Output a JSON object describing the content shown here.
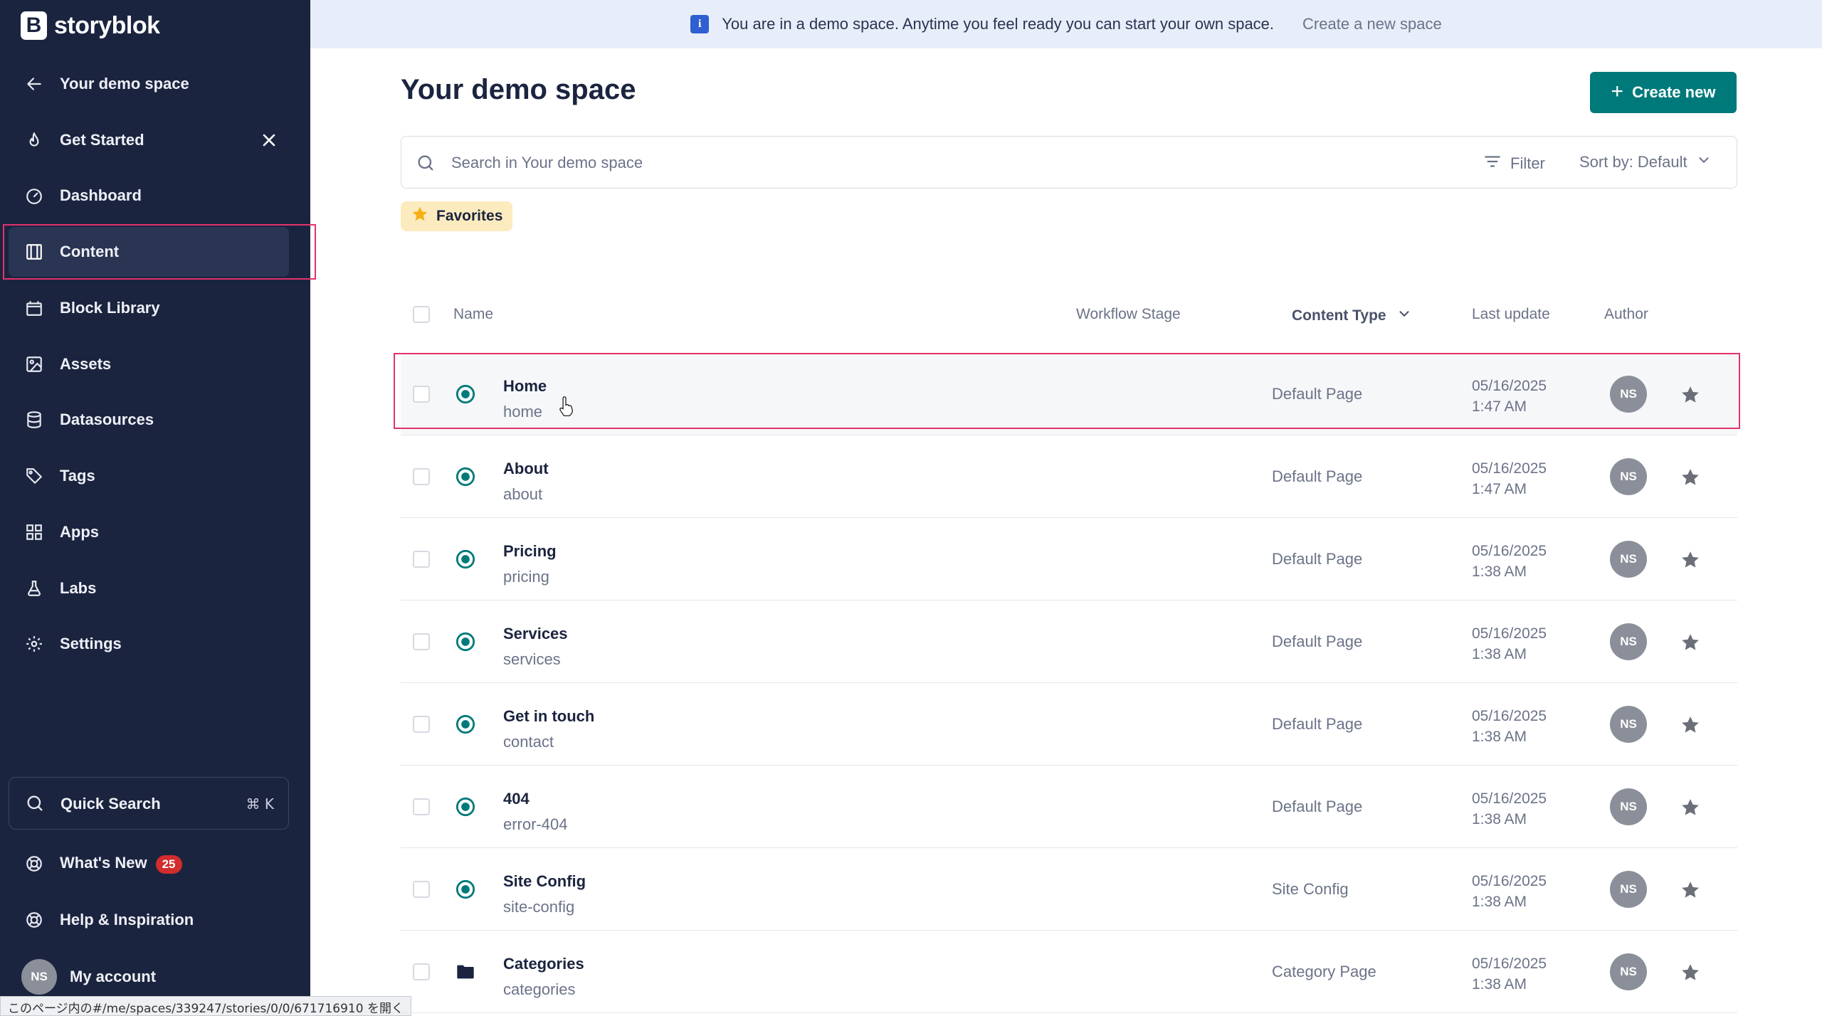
{
  "brand": {
    "logo_letter": "B",
    "name": "storyblok"
  },
  "sidebar": {
    "back_label": "Your demo space",
    "items": [
      {
        "label": "Get Started",
        "icon": "flame-icon"
      },
      {
        "label": "Dashboard",
        "icon": "gauge-icon"
      },
      {
        "label": "Content",
        "icon": "content-icon",
        "active": true
      },
      {
        "label": "Block Library",
        "icon": "block-library-icon"
      },
      {
        "label": "Assets",
        "icon": "image-icon"
      },
      {
        "label": "Datasources",
        "icon": "database-icon"
      },
      {
        "label": "Tags",
        "icon": "tag-icon"
      },
      {
        "label": "Apps",
        "icon": "apps-grid-icon"
      },
      {
        "label": "Labs",
        "icon": "flask-icon"
      },
      {
        "label": "Settings",
        "icon": "gear-icon"
      }
    ],
    "quick_search": {
      "label": "Quick Search",
      "shortcut": "⌘ K"
    },
    "whats_new": {
      "label": "What's New",
      "count": "25"
    },
    "help": {
      "label": "Help & Inspiration"
    },
    "account": {
      "initials": "NS",
      "label": "My account"
    }
  },
  "status_bar_url": "このページ内の#/me/spaces/339247/stories/0/0/671716910 を開く",
  "banner": {
    "message": "You are in a demo space. Anytime you feel ready you can start your own space.",
    "link": "Create a new space"
  },
  "main": {
    "title": "Your demo space",
    "create_button": "Create new",
    "search_placeholder": "Search in Your demo space",
    "filter_label": "Filter",
    "sort_label": "Sort by: Default",
    "favorites_label": "Favorites"
  },
  "table": {
    "headers": {
      "name": "Name",
      "workflow_stage": "Workflow Stage",
      "content_type": "Content Type",
      "last_update": "Last update",
      "author": "Author"
    },
    "rows": [
      {
        "name": "Home",
        "slug": "home",
        "type": "Default Page",
        "date": "05/16/2025",
        "time": "1:47 AM",
        "author": "NS",
        "kind": "story"
      },
      {
        "name": "About",
        "slug": "about",
        "type": "Default Page",
        "date": "05/16/2025",
        "time": "1:47 AM",
        "author": "NS",
        "kind": "story"
      },
      {
        "name": "Pricing",
        "slug": "pricing",
        "type": "Default Page",
        "date": "05/16/2025",
        "time": "1:38 AM",
        "author": "NS",
        "kind": "story"
      },
      {
        "name": "Services",
        "slug": "services",
        "type": "Default Page",
        "date": "05/16/2025",
        "time": "1:38 AM",
        "author": "NS",
        "kind": "story"
      },
      {
        "name": "Get in touch",
        "slug": "contact",
        "type": "Default Page",
        "date": "05/16/2025",
        "time": "1:38 AM",
        "author": "NS",
        "kind": "story"
      },
      {
        "name": "404",
        "slug": "error-404",
        "type": "Default Page",
        "date": "05/16/2025",
        "time": "1:38 AM",
        "author": "NS",
        "kind": "story"
      },
      {
        "name": "Site Config",
        "slug": "site-config",
        "type": "Site Config",
        "date": "05/16/2025",
        "time": "1:38 AM",
        "author": "NS",
        "kind": "story"
      },
      {
        "name": "Categories",
        "slug": "categories",
        "type": "Category Page",
        "date": "05/16/2025",
        "time": "1:38 AM",
        "author": "NS",
        "kind": "folder"
      }
    ]
  },
  "colors": {
    "sidebar_bg": "#1b243f",
    "accent_teal": "#00797a",
    "highlight_pink": "#e2336b",
    "favorites_bg": "#fcebbf",
    "star_grey": "#6b6f78",
    "badge_red": "#d22c2c"
  }
}
